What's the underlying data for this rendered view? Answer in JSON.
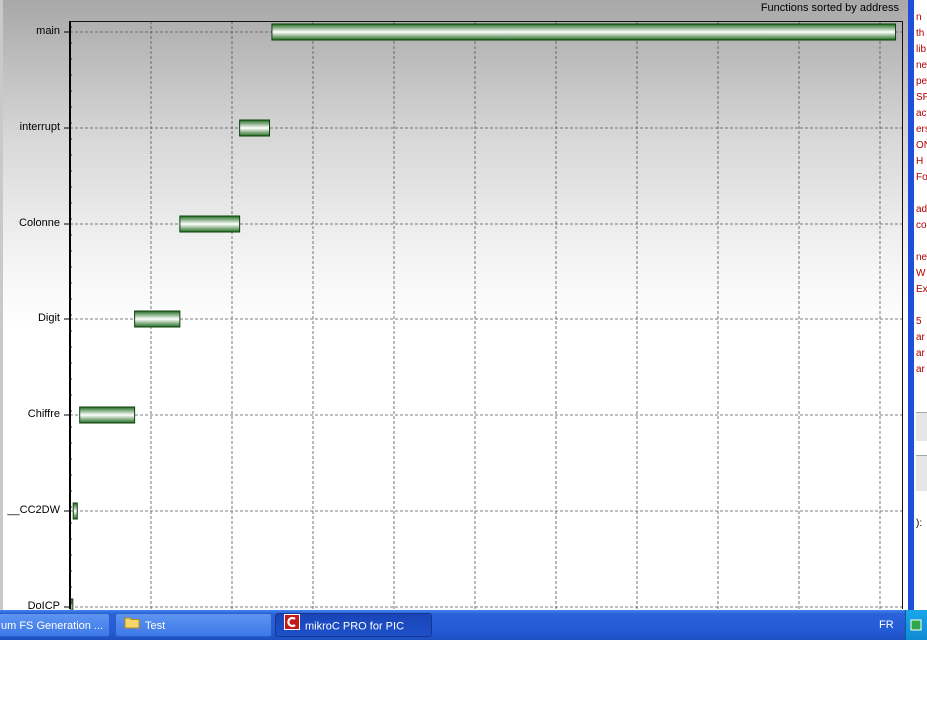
{
  "chart_data": {
    "type": "bar",
    "title": "Functions sorted by address",
    "categories": [
      "main",
      "interrupt",
      "Colonne",
      "Digit",
      "Chiffre",
      "__CC2DW",
      "DoICP"
    ],
    "series": [
      {
        "start": [
          250,
          210,
          136,
          80,
          12,
          4,
          1
        ],
        "end": [
          1022,
          247,
          210,
          136,
          80,
          9,
          3
        ]
      }
    ],
    "xlim": [
      0,
      1030
    ],
    "grid": true
  },
  "right_panel": {
    "lines": [
      "n",
      "th",
      "lib",
      "ne",
      "pe",
      "SP",
      "ac",
      "ers",
      "ON",
      "H",
      "Fo",
      "",
      "ad",
      "cor",
      "",
      "ne",
      "W",
      "Ex",
      "",
      "5",
      "ar",
      "ar",
      "ar"
    ],
    "bottom_text": "):"
  },
  "taskbar": {
    "buttons": [
      {
        "label": "um FS Generation ...",
        "icon": ""
      },
      {
        "label": "Test",
        "icon": "folder-icon"
      },
      {
        "label": "mikroC PRO for PIC",
        "icon": "mikroc-icon"
      }
    ],
    "language": "FR"
  },
  "colors": {
    "bar_dark": "#1f6b1f",
    "bar_light": "#ffffff",
    "taskbar": "#245bd6"
  }
}
